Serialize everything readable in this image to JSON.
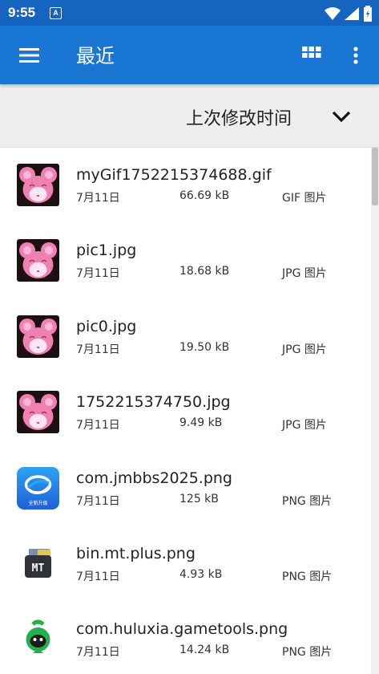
{
  "status_bar": {
    "time": "9:55",
    "notification_letter": "A"
  },
  "app_bar": {
    "title": "最近"
  },
  "sort_bar": {
    "label": "上次修改时间"
  },
  "files": [
    {
      "name": "myGif1752215374688.gif",
      "date": "7月11日",
      "size": "66.69 kB",
      "type": "GIF 图片",
      "thumb": "pink-mouse"
    },
    {
      "name": "pic1.jpg",
      "date": "7月11日",
      "size": "18.68 kB",
      "type": "JPG 图片",
      "thumb": "pink-mouse"
    },
    {
      "name": "pic0.jpg",
      "date": "7月11日",
      "size": "19.50 kB",
      "type": "JPG 图片",
      "thumb": "pink-mouse"
    },
    {
      "name": "1752215374750.jpg",
      "date": "7月11日",
      "size": "9.49 kB",
      "type": "JPG 图片",
      "thumb": "pink-mouse"
    },
    {
      "name": "com.jmbbs2025.png",
      "date": "7月11日",
      "size": "125 kB",
      "type": "PNG 图片",
      "thumb": "jmbbs-app",
      "thumb_caption": "全新升级"
    },
    {
      "name": "bin.mt.plus.png",
      "date": "7月11日",
      "size": "4.93 kB",
      "type": "PNG 图片",
      "thumb": "mt-manager-app",
      "thumb_caption": "MT"
    },
    {
      "name": "com.huluxia.gametools.png",
      "date": "7月11日",
      "size": "14.24 kB",
      "type": "PNG 图片",
      "thumb": "huluxia-app"
    }
  ],
  "colors": {
    "status_bar": "#1565c0",
    "app_bar": "#1976d2",
    "sort_bar": "#eeeeee"
  },
  "icons": {
    "menu": "hamburger-menu-icon",
    "view": "grid-view-icon",
    "more": "more-vert-icon",
    "sort": "chevron-down-icon"
  }
}
